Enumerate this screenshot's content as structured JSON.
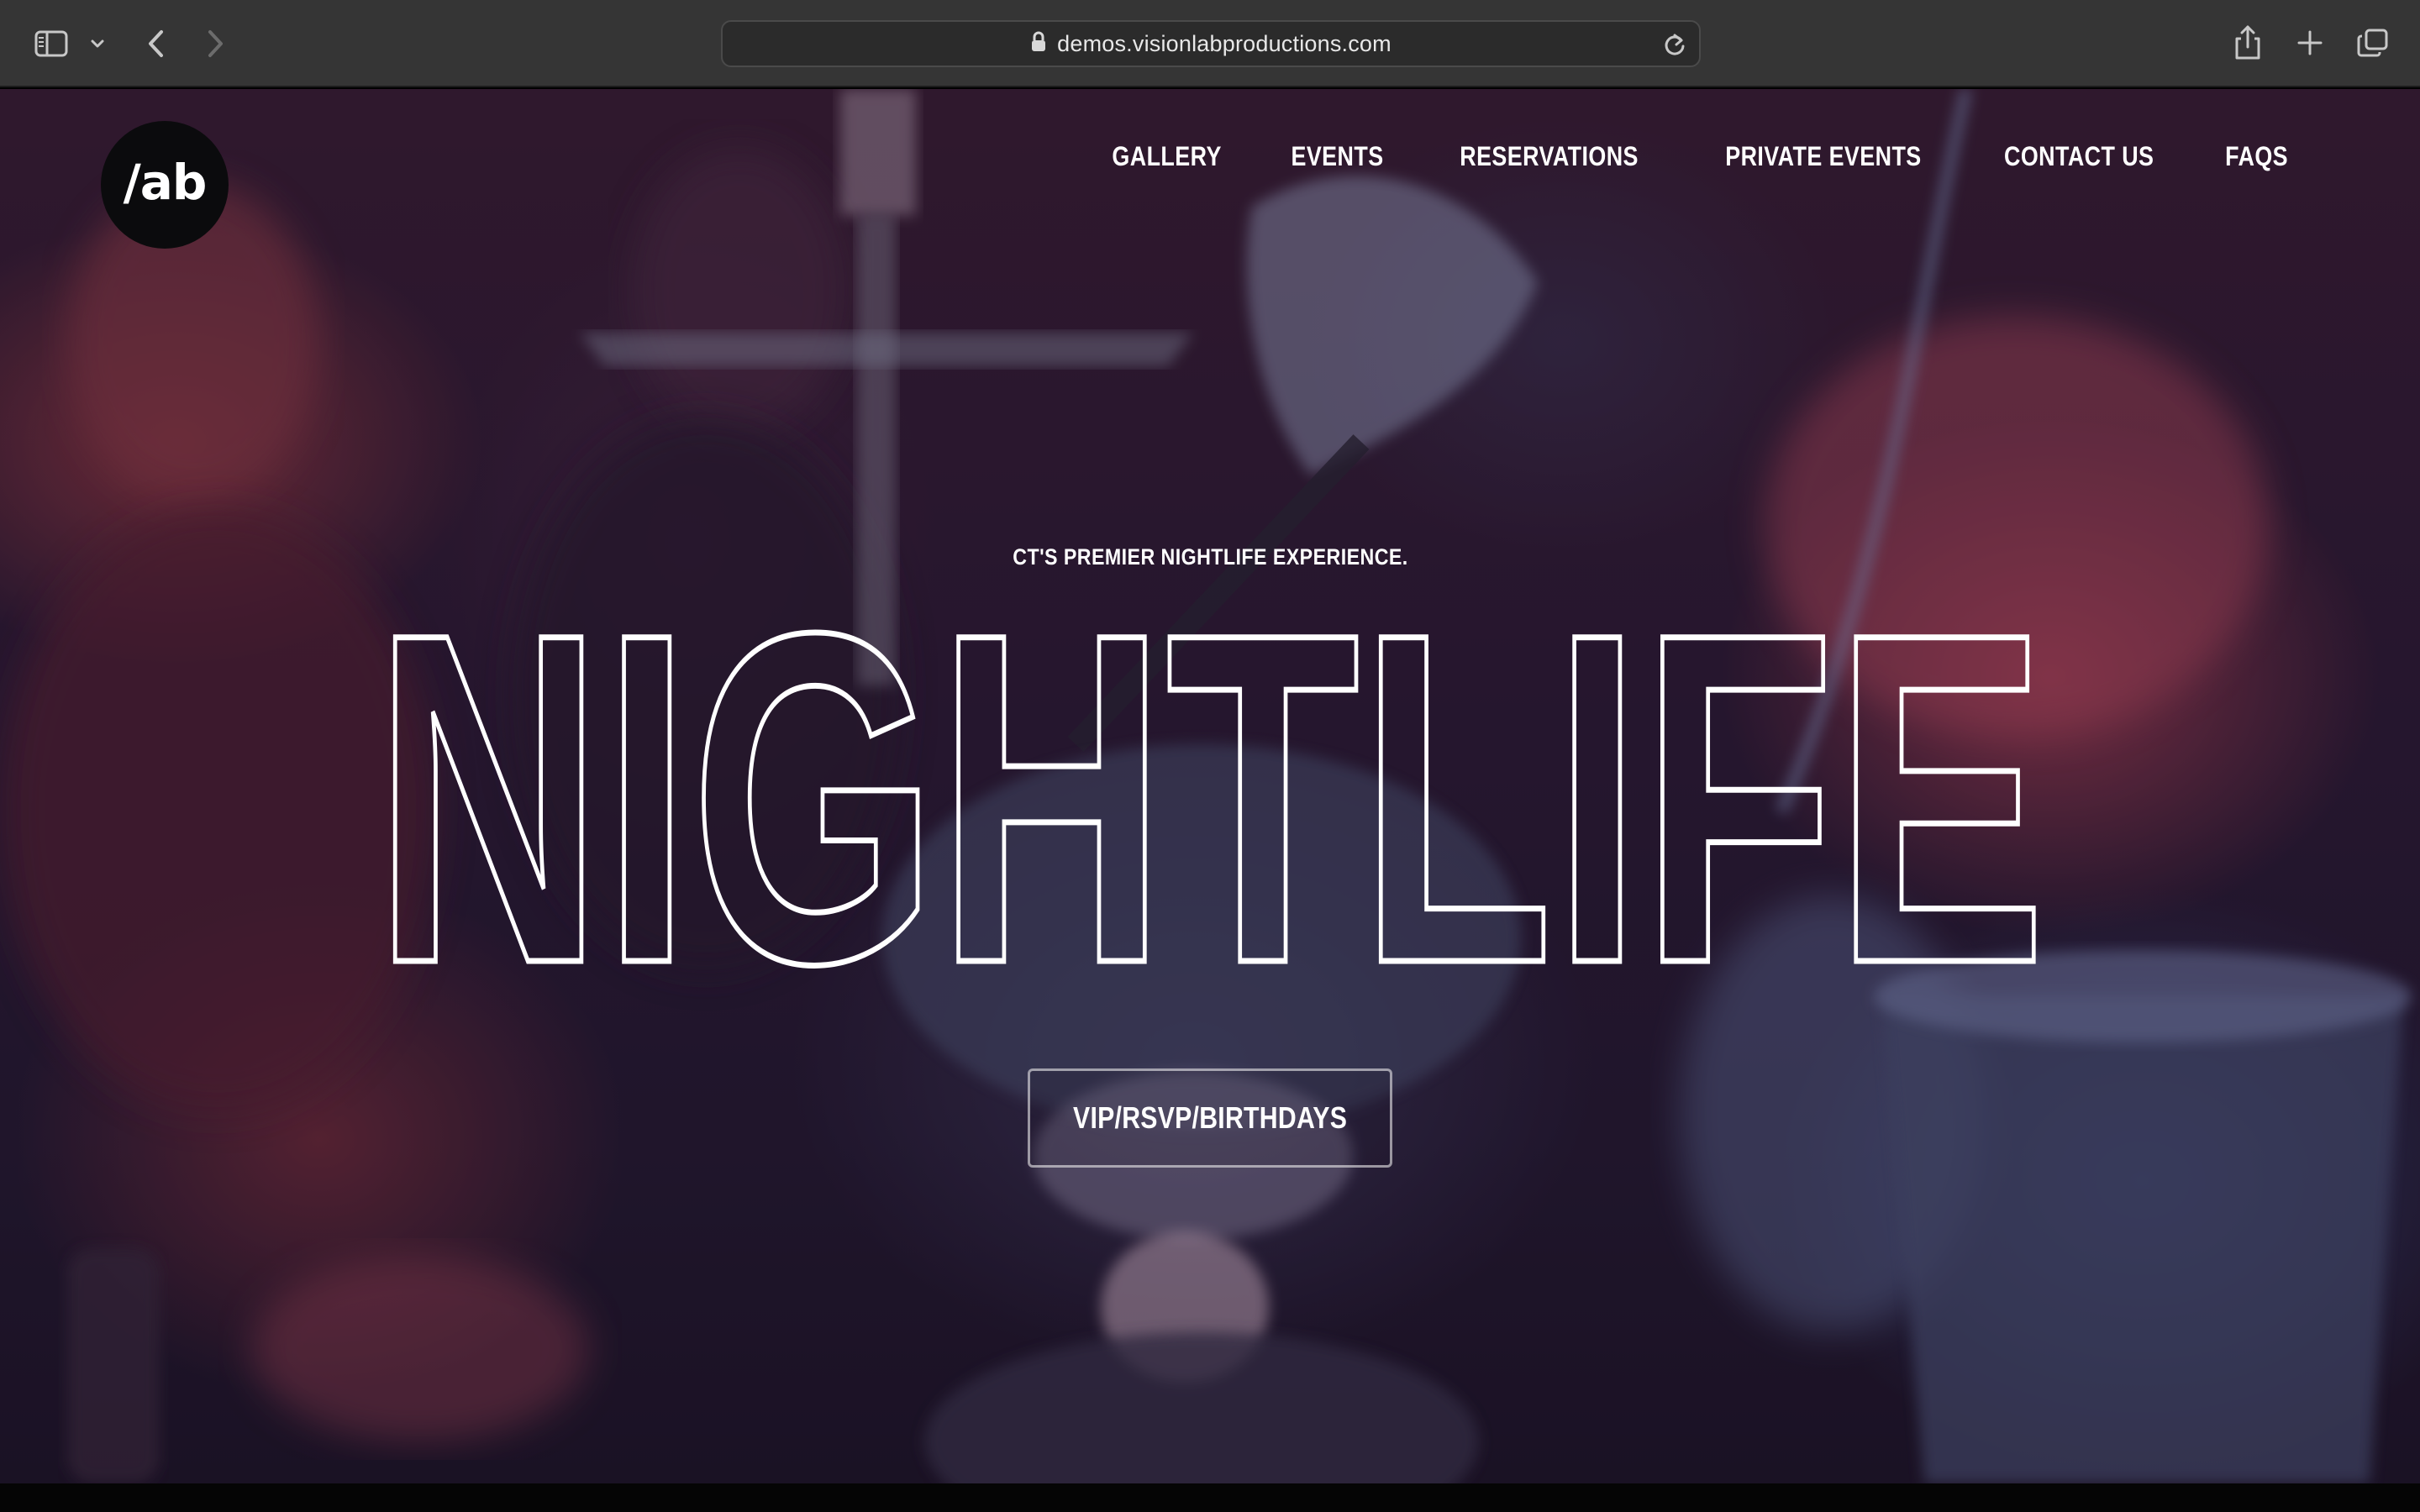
{
  "browser": {
    "url": "demos.visionlabproductions.com",
    "icons": {
      "sidebar": "sidebar-icon",
      "chevron": "chevron-down-icon",
      "back": "back-arrow-icon",
      "forward": "forward-arrow-icon",
      "lock": "lock-icon",
      "reload": "reload-icon",
      "share": "share-icon",
      "new_tab": "plus-icon",
      "tab_overview": "tabs-icon"
    }
  },
  "site": {
    "logo_text": "/ab",
    "nav": [
      {
        "label": "GALLERY"
      },
      {
        "label": "EVENTS"
      },
      {
        "label": "RESERVATIONS"
      },
      {
        "label": "PRIVATE EVENTS"
      },
      {
        "label": "CONTACT US"
      },
      {
        "label": "FAQS"
      }
    ],
    "hero": {
      "tagline": "CT'S PREMIER NIGHTLIFE EXPERIENCE.",
      "headline": "NIGHTLIFE",
      "cta_label": "VIP/RSVP/BIRTHDAYS"
    }
  },
  "colors": {
    "chrome_bg": "#353535",
    "text": "#ffffff",
    "logo_bg": "#0b0b0d"
  }
}
